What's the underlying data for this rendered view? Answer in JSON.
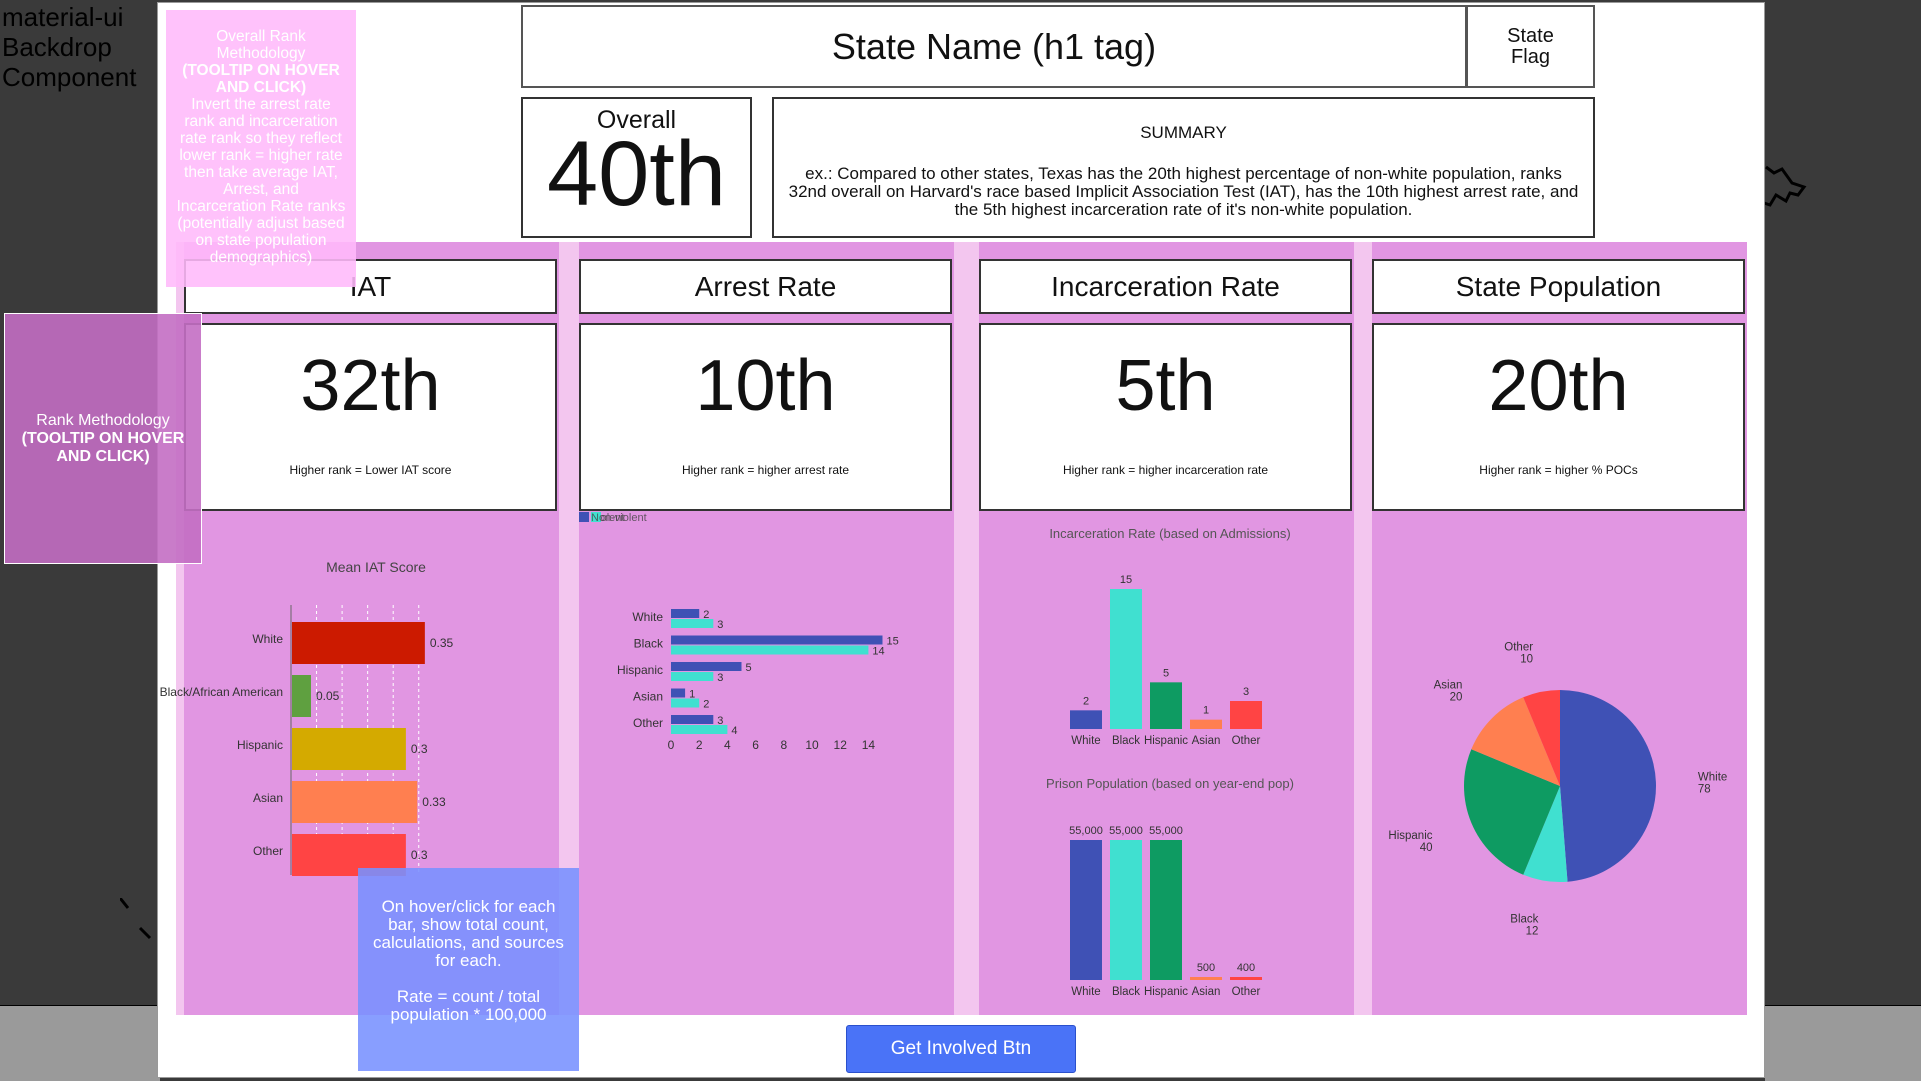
{
  "backdrop": {
    "label_lines": [
      "material-ui",
      "Backdrop",
      "Component"
    ]
  },
  "header": {
    "state_name": "State Name (h1 tag)",
    "flag_lines": [
      "State",
      "Flag"
    ]
  },
  "overall": {
    "label": "Overall",
    "rank": "40th"
  },
  "summary": {
    "title": "SUMMARY",
    "text": "ex.: Compared to other states, Texas has the 20th highest percentage of non-white population, ranks 32nd overall on Harvard's race based Implicit Association Test (IAT), has the 10th highest arrest rate, and the 5th highest incarceration rate of it's non-white population."
  },
  "sections": [
    {
      "title": "IAT",
      "rank": "32th",
      "note": "Higher rank = Lower IAT score"
    },
    {
      "title": "Arrest Rate",
      "rank": "10th",
      "note": "Higher rank = higher arrest rate"
    },
    {
      "title": "Incarceration Rate",
      "rank": "5th",
      "note": "Higher rank = higher incarceration rate"
    },
    {
      "title": "State Population",
      "rank": "20th",
      "note": "Higher rank = higher % POCs"
    }
  ],
  "tooltips": {
    "overall_lines": [
      "Overall Rank",
      "Methodology"
    ],
    "overall_bold_lines": [
      "(TOOLTIP ON HOVER",
      "AND CLICK)"
    ],
    "overall_body_lines": [
      "Invert the arrest rate",
      "rank and incarceration",
      "rate rank so they reflect",
      "lower rank = higher rate",
      "then take average IAT,",
      "Arrest, and",
      "Incarceration Rate ranks",
      "(potentially adjust based",
      "on state population",
      "demographics)"
    ],
    "rank_line": "Rank Methodology",
    "rank_bold_lines": [
      "(TOOLTIP ON HOVER",
      "AND CLICK)"
    ],
    "hover_p1_lines": [
      "On hover/click for each",
      "bar, show total count,",
      "calculations, and sources",
      "for each."
    ],
    "hover_p2_lines": [
      "Rate = count / total",
      "population * 100,000"
    ]
  },
  "cta": {
    "label": "Get Involved Btn"
  },
  "colors": {
    "white": "#3f51b5",
    "black": "#40e0d0",
    "hispanic": "#0e9b62",
    "asian": "#ff7f50",
    "other": "#ff4444"
  },
  "chart_data": [
    {
      "type": "bar",
      "orientation": "horizontal",
      "title": "Mean IAT Score",
      "categories": [
        "White",
        "Black/African American",
        "Hispanic",
        "Asian",
        "Other"
      ],
      "values": [
        0.35,
        0.05,
        0.3,
        0.33,
        0.3
      ],
      "labels": [
        "0.35",
        "0.05",
        "0.3",
        "0.33",
        "0.3"
      ],
      "colors": [
        "#cc1a00",
        "#5fa040",
        "#d4aa00",
        "#ff7f50",
        "#ff4444"
      ]
    },
    {
      "type": "bar",
      "orientation": "horizontal",
      "categories": [
        "White",
        "Black",
        "Hispanic",
        "Asian",
        "Other"
      ],
      "series": [
        {
          "name": "Violent",
          "color": "#3f51b5",
          "values": [
            2,
            15,
            5,
            1,
            3
          ]
        },
        {
          "name": "Non-violent",
          "color": "#40e0d0",
          "values": [
            3,
            14,
            3,
            2,
            4
          ]
        }
      ],
      "x_ticks": [
        "0",
        "2",
        "4",
        "6",
        "8",
        "10",
        "12",
        "14"
      ],
      "xlim": [
        0,
        15
      ],
      "legend_position": "top-left"
    },
    {
      "type": "bar",
      "title": "Incarceration Rate (based on Admissions)",
      "categories": [
        "White",
        "Black",
        "Hispanic",
        "Asian",
        "Other"
      ],
      "values": [
        2,
        15,
        5,
        1,
        3
      ],
      "labels": [
        "2",
        "15",
        "5",
        "1",
        "3"
      ],
      "colors": [
        "#3f51b5",
        "#40e0d0",
        "#0e9b62",
        "#ff7f50",
        "#ff4444"
      ]
    },
    {
      "type": "bar",
      "title": "Prison Population (based on year-end pop)",
      "categories": [
        "White",
        "Black",
        "Hispanic",
        "Asian",
        "Other"
      ],
      "values": [
        55000,
        55000,
        55000,
        500,
        400
      ],
      "labels": [
        "55,000",
        "55,000",
        "55,000",
        "500",
        "400"
      ],
      "colors": [
        "#3f51b5",
        "#40e0d0",
        "#0e9b62",
        "#ff7f50",
        "#ff4444"
      ]
    },
    {
      "type": "pie",
      "categories": [
        "White",
        "Black",
        "Hispanic",
        "Asian",
        "Other"
      ],
      "values": [
        78,
        12,
        40,
        20,
        10
      ],
      "colors": [
        "#3f51b5",
        "#40e0d0",
        "#0e9b62",
        "#ff7f50",
        "#ff4444"
      ]
    }
  ]
}
